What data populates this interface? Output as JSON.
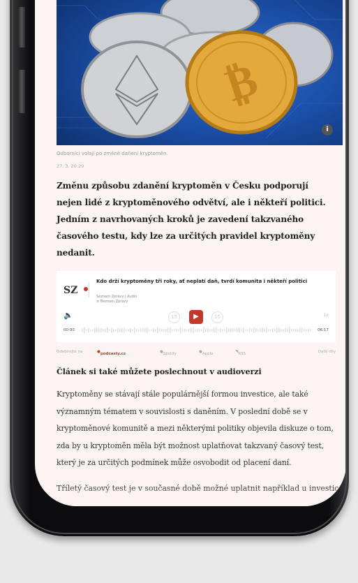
{
  "image": {
    "alt": "Kryptoměny – ilustrační foto",
    "info_icon": "info-icon"
  },
  "article": {
    "caption": "Odborníci volají po změně daňení kryptoměn.",
    "date": "27. 3. 20:29",
    "lead": "Změnu způsobu zdanění kryptoměn v Česku podporují nejen lidé z kryptoměnového odvětví, ale i někteří politici. Jedním z navrhovaných kroků je zavedení takzvaného časového testu, kdy lze za určitých pravidel kryptoměny nedanit."
  },
  "player": {
    "logo": "SZ",
    "title": "Kdo drží kryptoměny tři roky, ať neplatí daň, tvrdí komunita i někteří politici",
    "meta": "Seznam Zprávy | Audio",
    "publisher": "Beznam Zprávy",
    "rewind": "15",
    "forward": "15",
    "speed": "1x",
    "time_start": "00:00",
    "time_end": "06:17",
    "subscribe_label": "Odebírejte na",
    "platforms": [
      "podcasty.cz",
      "Spotify",
      "Apple",
      "RSS"
    ],
    "more_episodes": "Další díly"
  },
  "listen_heading": "Článek si také můžete poslechnout v audioverzi",
  "body_paragraph": "Kryptoměny se stávají stále populárnější formou investice, ale také významným tématem v souvislosti s daněním. V poslední době se v kryptoměnové komunitě a mezi některými politiky objevila diskuze o tom, zda by u kryptoměn měla být možnost uplatňovat takzvaný časový test, který je za určitých podmínek může osvobodit od placení daní.",
  "body_paragraph2": "Tříletý časový test je v současné době možné uplatnit například u investic"
}
